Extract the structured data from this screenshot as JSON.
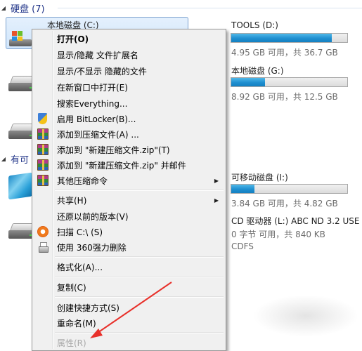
{
  "explorer": {
    "groups": {
      "hard_disks": "硬盘 (7)",
      "removable": "有可"
    },
    "drives": {
      "c": {
        "name": "本地磁盘 (C:)"
      },
      "d": {
        "name": "TOOLS (D:)",
        "info": "4.95 GB 可用，共 36.7 GB",
        "used_fraction": 0.865
      },
      "g": {
        "name": "本地磁盘 (G:)",
        "info": "8.92 GB 可用，共 12.5 GB",
        "used_fraction": 0.29
      },
      "i": {
        "name": "可移动磁盘 (I:)",
        "info": "3.84 GB 可用，共 4.82 GB",
        "used_fraction": 0.2
      },
      "l": {
        "name": "CD 驱动器 (L:) ABC ND 3.2 USE",
        "info": "0 字节 可用，共 840 KB",
        "fs": "CDFS"
      }
    }
  },
  "context_menu": {
    "items": [
      {
        "label": "打开(O)"
      },
      {
        "label": "显示/隐藏 文件扩展名"
      },
      {
        "label": "显示/不显示 隐藏的文件"
      },
      {
        "label": "在新窗口中打开(E)"
      },
      {
        "label": "搜索Everything..."
      },
      {
        "label": "启用 BitLocker(B)...",
        "icon": "uac-shield-icon"
      },
      {
        "label": "添加到压缩文件(A) ...",
        "icon": "winrar-icon"
      },
      {
        "label": "添加到 \"新建压缩文件.zip\"(T)",
        "icon": "winrar-icon"
      },
      {
        "label": "添加到 \"新建压缩文件.zip\" 并邮件",
        "icon": "winrar-icon"
      },
      {
        "label": "其他压缩命令",
        "icon": "winrar-icon"
      },
      {
        "label": "共享(H)"
      },
      {
        "label": "还原以前的版本(V)"
      },
      {
        "label": "扫描 C:\\ (S)",
        "icon": "360-icon"
      },
      {
        "label": "使用 360强力删除",
        "icon": "shredder-icon"
      },
      {
        "label": "格式化(A)..."
      },
      {
        "label": "复制(C)"
      },
      {
        "label": "创建快捷方式(S)"
      },
      {
        "label": "重命名(M)"
      },
      {
        "label": "属性(R)"
      }
    ]
  },
  "annotation": {
    "arrow_color": "#e8302a"
  }
}
